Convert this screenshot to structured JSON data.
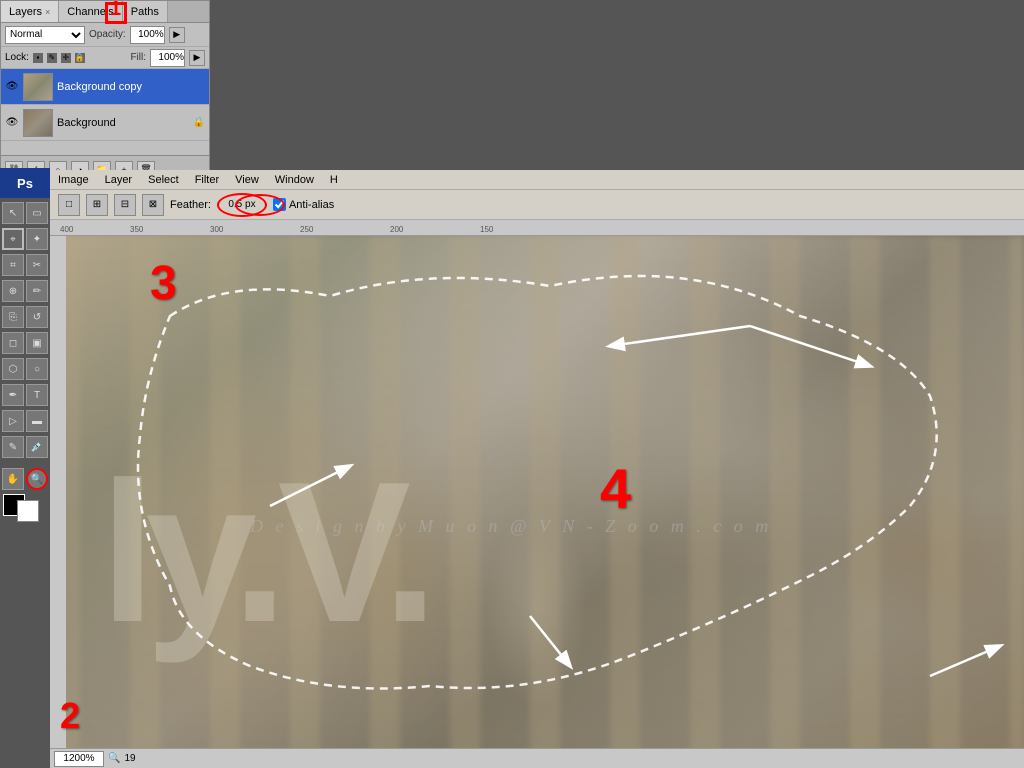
{
  "panel": {
    "tabs": [
      {
        "label": "Layers",
        "active": true,
        "close": "x"
      },
      {
        "label": "Channels"
      },
      {
        "label": "Paths"
      }
    ],
    "blend_mode": "Normal",
    "opacity_label": "Opacity:",
    "opacity_value": "100%",
    "lock_label": "Lock:",
    "fill_label": "Fill:",
    "fill_value": "100%",
    "layers": [
      {
        "name": "Background copy",
        "active": true,
        "visible": true
      },
      {
        "name": "Background",
        "active": false,
        "visible": true,
        "locked": true
      }
    ]
  },
  "menu": {
    "items": [
      "Image",
      "Layer",
      "Select",
      "Filter",
      "View",
      "Window",
      "H"
    ]
  },
  "options": {
    "feather_label": "Feather:",
    "feather_value": "0.5 px",
    "anti_alias_label": "Anti-alias",
    "anti_alias_checked": true
  },
  "watermark": "D e s i g n   b y   M u o n @ V N - Z o o m . c o m",
  "annotations": {
    "num1": "1",
    "num2": "2",
    "num3": "3",
    "num4": "4"
  },
  "status": {
    "zoom": "1200%"
  },
  "ruler": {
    "marks": [
      "400",
      "350",
      "300",
      "250",
      "200",
      "150"
    ]
  },
  "ps_logo": "Ps"
}
